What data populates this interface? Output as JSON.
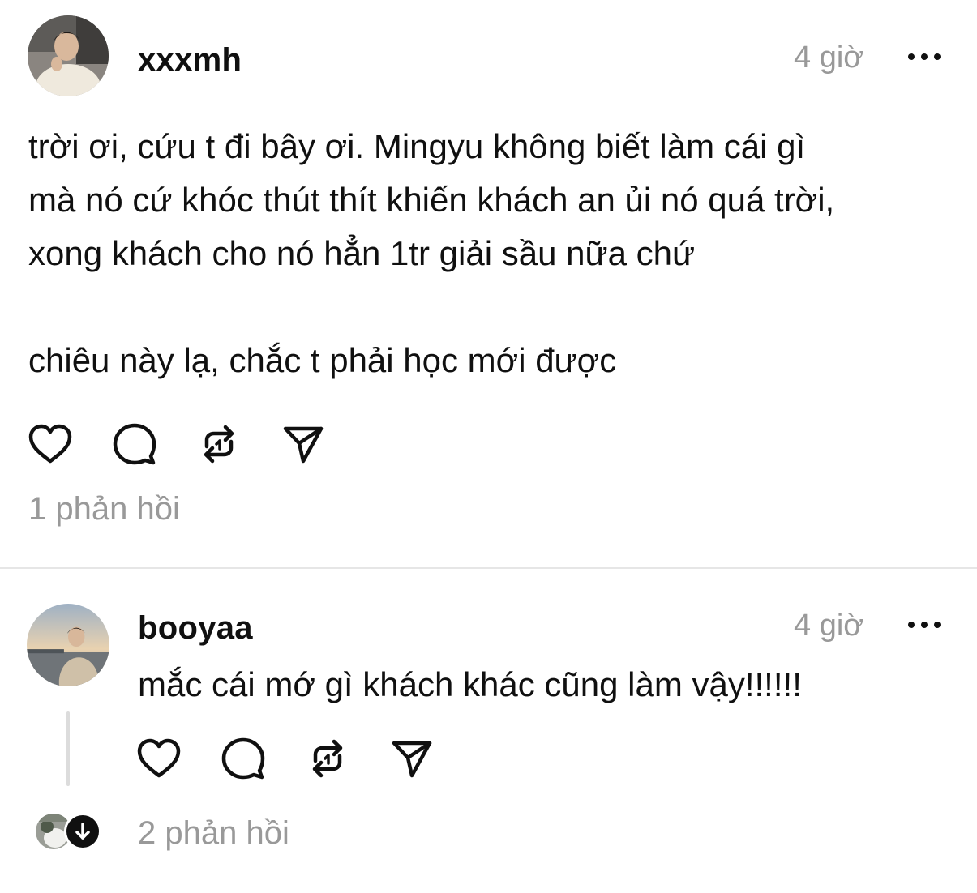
{
  "post": {
    "username": "xxxmh",
    "timestamp": "4 giờ",
    "text": "trời ơi, cứu t đi bây ơi. Mingyu không biết làm cái gì\nmà nó cứ khóc thút thít khiến khách an ủi nó quá trời,\nxong khách cho nó hẳn 1tr giải sầu nữa chứ\n\nchiêu này lạ, chắc t phải học mới được",
    "replies_label": "1 phản hồi"
  },
  "reply": {
    "username": "booyaa",
    "timestamp": "4 giờ",
    "text": "mắc cái mớ gì khách khác cũng làm vậy!!!!!!",
    "replies_label": "2 phản hồi"
  },
  "icons": {
    "like": "heart-icon",
    "comment": "comment-icon",
    "repost": "repost-icon",
    "share": "send-icon",
    "more": "more-icon",
    "expand": "arrow-down-icon"
  },
  "colors": {
    "text": "#101010",
    "muted": "#999999",
    "divider": "#e6e6e6"
  }
}
